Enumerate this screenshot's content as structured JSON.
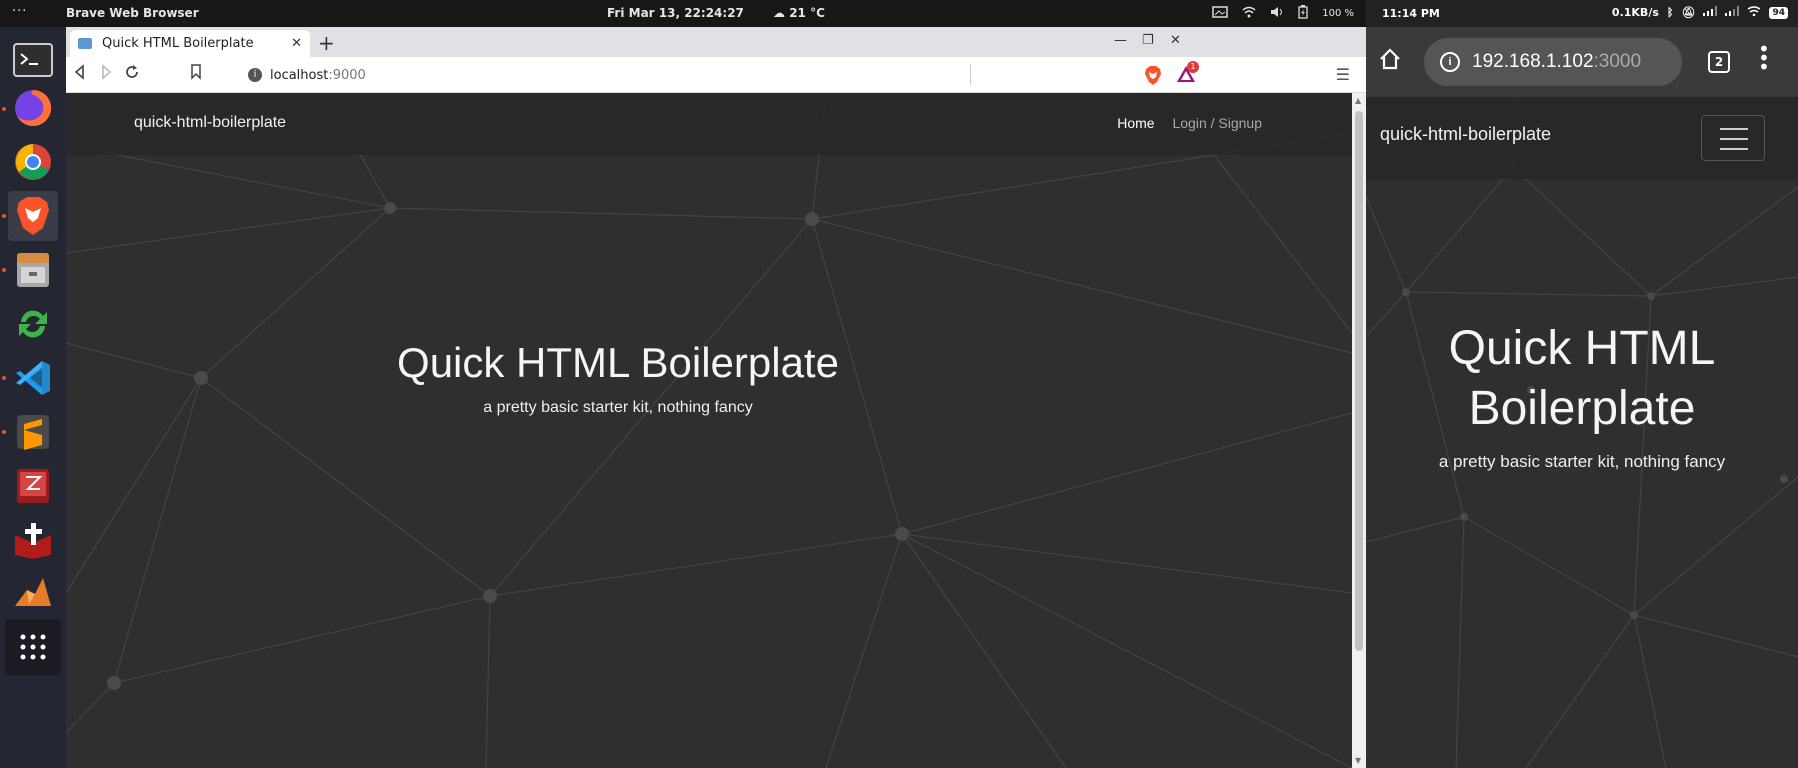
{
  "topbar": {
    "activities": "···",
    "app_name": "Brave Web Browser",
    "clock": "Fri Mar 13, 22:24:27",
    "weather": "21 °C",
    "battery": "100 %"
  },
  "browser": {
    "tab_title": "Quick HTML Boilerplate",
    "url_host": "localhost",
    "url_port": ":9000",
    "rewards_badge": "1"
  },
  "site": {
    "brand": "quick-html-boilerplate",
    "nav_home": "Home",
    "nav_login": "Login / Signup",
    "hero_title": "Quick HTML Boilerplate",
    "hero_subtitle": "a pretty basic starter kit, nothing fancy"
  },
  "phone": {
    "time": "11:14 PM",
    "net_speed": "0.1KB/s",
    "battery": "94",
    "url_host": "192.168.1.102",
    "url_port": ":3000",
    "tab_count": "2",
    "brand": "quick-html-boilerplate",
    "hero_title_line1": "Quick HTML",
    "hero_title_line2": "Boilerplate",
    "hero_subtitle": "a pretty basic starter kit, nothing fancy"
  },
  "colors": {
    "page_bg": "#2f2f2f",
    "network_lines": "#444444",
    "network_nodes": "#4a4a4a",
    "dock_bg": "#242632",
    "brave_orange": "#fb542b"
  }
}
